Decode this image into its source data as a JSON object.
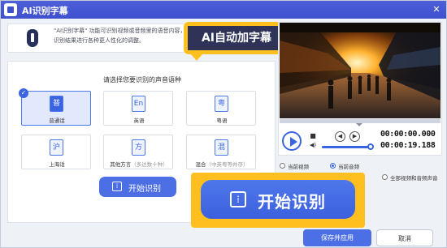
{
  "window": {
    "title": "AI识别字幕",
    "close_glyph": "✕"
  },
  "info": {
    "text": "\"AI识别字幕\" 功能可识别视频或音频里的语音内容，自动\n识别结果进行各种更人性化的调整。",
    "icon": "info-bulb-icon"
  },
  "callout": {
    "label": "AI自动加字幕"
  },
  "main": {
    "prompt": "请选择您要识别的声音语种",
    "languages": [
      {
        "icon_char": "普",
        "label": "普通话",
        "note": "",
        "selected": true
      },
      {
        "icon_char": "En",
        "label": "英语",
        "note": "",
        "selected": false
      },
      {
        "icon_char": "粤",
        "label": "粤语",
        "note": "",
        "selected": false
      },
      {
        "icon_char": "沪",
        "label": "上海话",
        "note": "",
        "selected": false
      },
      {
        "icon_char": "方",
        "label": "其他方言",
        "note": "（多达数十种）",
        "selected": false
      },
      {
        "icon_char": "混",
        "label": "混合",
        "note": "（中英粤等并存）",
        "selected": false
      }
    ],
    "start_label": "开始识别",
    "check_glyph": "✓",
    "wave_glyph": "⁞"
  },
  "player": {
    "current_time": "00:00:00.000",
    "total_time": "00:00:19.188",
    "progress": 0.0,
    "volume": 0.95,
    "stop_glyph": "■",
    "prev_glyph": "◀",
    "next_glyph": "▶",
    "volume_glyph": "◀)"
  },
  "source_options": [
    {
      "label": "当前视频",
      "selected": false
    },
    {
      "label": "当前音频",
      "selected": true
    },
    {
      "label": "全部视频和音频声音",
      "selected": false
    }
  ],
  "big_start": {
    "label": "开始识别"
  },
  "footer": {
    "save_label": "保存并应用",
    "cancel_label": "取消"
  },
  "colors": {
    "accent": "#3a64e0",
    "highlight": "#ffbf1f",
    "titlebar": "#3f50cf"
  }
}
